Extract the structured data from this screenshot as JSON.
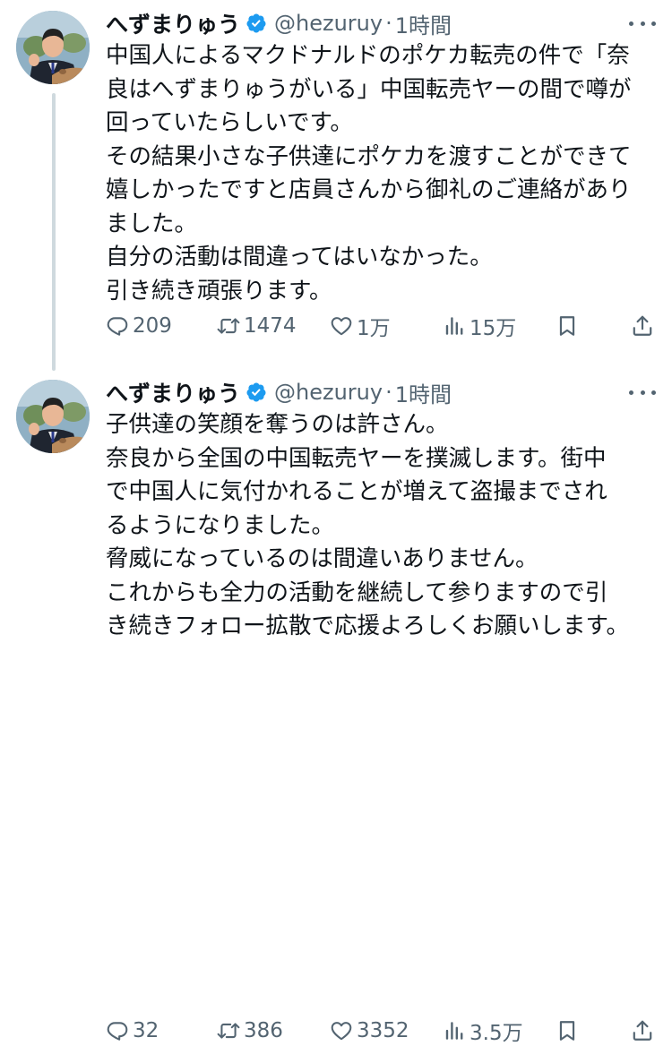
{
  "tweets": [
    {
      "name": "へずまりゅう",
      "handle": "@hezuruy",
      "separator": "·",
      "time": "1時間",
      "lines": [
        "中国人によるマクドナルドのポケカ転売の件で「奈",
        "良はへずまりゅうがいる」中国転売ヤーの間で噂が",
        "回っていたらしいです。",
        "その結果小さな子供達にポケカを渡すことができて",
        "嬉しかったですと店員さんから御礼のご連絡があり",
        "ました。",
        "自分の活動は間違ってはいなかった。",
        "引き続き頑張ります。"
      ],
      "stats": {
        "replies": "209",
        "retweets": "1474",
        "likes": "1万",
        "views": "15万"
      }
    },
    {
      "name": "へずまりゅう",
      "handle": "@hezuruy",
      "separator": "·",
      "time": "1時間",
      "lines": [
        "子供達の笑顔を奪うのは許さん。",
        "奈良から全国の中国転売ヤーを撲滅します。街中",
        "で中国人に気付かれることが増えて盗撮までされ",
        "るようになりました。",
        "脅威になっているのは間違いありません。",
        "これからも全力の活動を継続して参りますので引",
        "き続きフォロー拡散で応援よろしくお願いします。"
      ],
      "stats": {
        "replies": "32",
        "retweets": "386",
        "likes": "3352",
        "views": "3.5万"
      }
    }
  ],
  "colors": {
    "text": "#0f1419",
    "secondary": "#536471",
    "verified": "#1d9bf0",
    "thread_line": "#cfd9de"
  },
  "icons": {
    "reply": "reply-icon",
    "retweet": "retweet-icon",
    "like": "heart-icon",
    "views": "views-chart-icon",
    "bookmark": "bookmark-icon",
    "share": "share-icon",
    "more": "more-dots-icon",
    "verified": "verified-badge-icon"
  }
}
